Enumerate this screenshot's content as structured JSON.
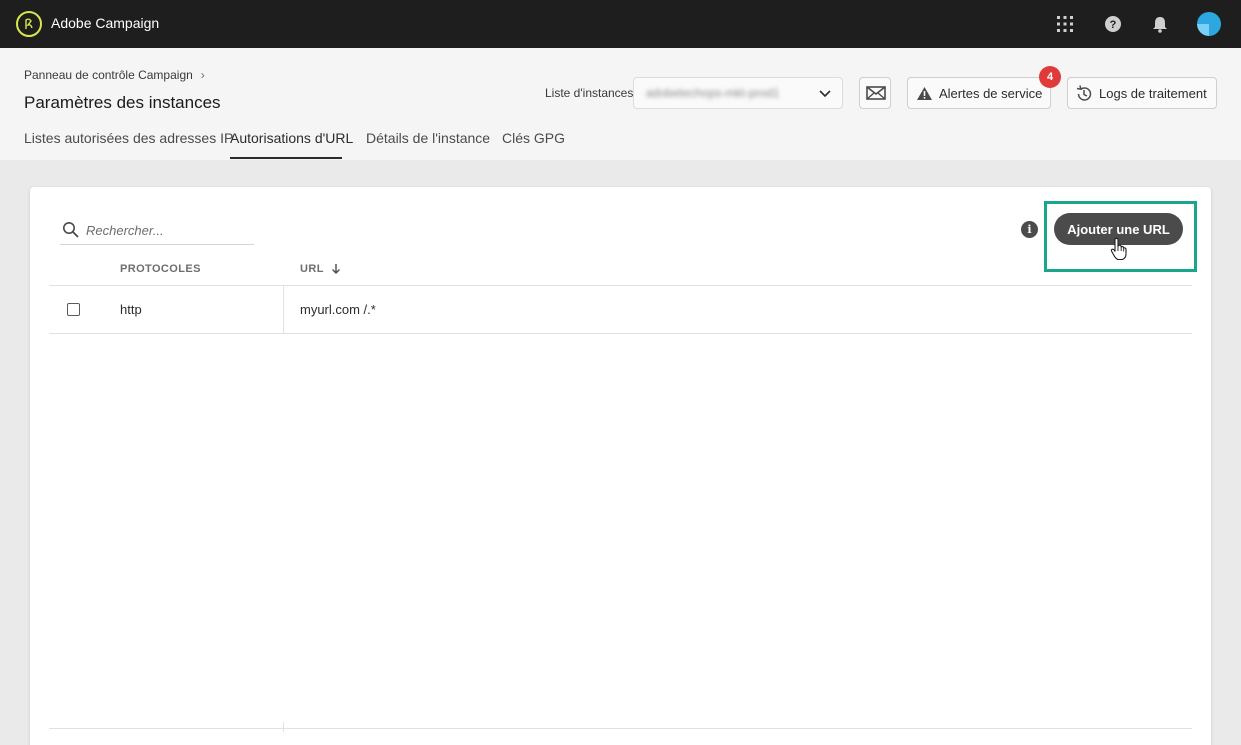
{
  "app": {
    "title": "Adobe Campaign"
  },
  "topbar": {
    "icons": [
      "apps-grid-icon",
      "help-icon",
      "bell-icon",
      "user-avatar"
    ]
  },
  "header": {
    "breadcrumb": "Panneau de contrôle Campaign",
    "page_title": "Paramètres des instances",
    "instance_label": "Liste d'instances",
    "instance_value": "adobetechops-mkt-prod1",
    "alerts_label": "Alertes de service",
    "alerts_count": "4",
    "logs_label": "Logs de traitement"
  },
  "tabs": [
    {
      "label": "Listes autorisées des adresses IP",
      "active": false
    },
    {
      "label": "Autorisations d'URL",
      "active": true
    },
    {
      "label": "Détails de l'instance",
      "active": false
    },
    {
      "label": "Clés GPG",
      "active": false
    }
  ],
  "main": {
    "search_placeholder": "Rechercher...",
    "add_button_label": "Ajouter une URL",
    "columns": [
      "PROTOCOLES",
      "URL"
    ],
    "sort_column": "URL",
    "rows": [
      {
        "checked": false,
        "protocol": "http",
        "url": "myurl.com /.*"
      }
    ]
  },
  "colors": {
    "topbar": "#1e1e1e",
    "highlight": "#1aa68a",
    "badge": "#e03b3b",
    "primary_button": "#4b4b4b"
  }
}
